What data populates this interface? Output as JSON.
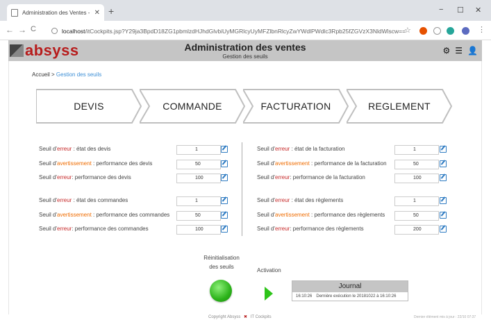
{
  "browser": {
    "tab_title": "Administration des Ventes - gestic",
    "tab_close": "✕",
    "new_tab": "+",
    "url_host": "localhost",
    "url_path": "/itCockpits.jsp?Y29ja3BpdD18ZG1pbmlzdHJhdGlvbiUyMGRlcyUyMFZlbnRlcyZwYWdlPWdlc3Rpb25fZGVzX3NldWlscw==",
    "nav_back": "←",
    "nav_forward": "→",
    "nav_reload": "C",
    "star": "☆",
    "win_minimize": "−",
    "win_maximize": "☐",
    "win_close": "✕",
    "menu": "⋮"
  },
  "header": {
    "logo": "absyss",
    "title": "Administration des ventes",
    "subtitle": "Gestion des seuils",
    "icons": [
      "gear-icon",
      "list-icon",
      "user-icon"
    ]
  },
  "breadcrumb": {
    "home": "Accueil",
    "sep": " > ",
    "current": "Gestion des seuils"
  },
  "process_steps": [
    "DEVIS",
    "COMMANDE",
    "FACTURATION",
    "REGLEMENT"
  ],
  "thresholds": {
    "left": [
      {
        "pre": "Seuil d'",
        "kind": "erreur",
        "post": " : état des devis",
        "value": "1"
      },
      {
        "pre": "Seuil d'",
        "kind": "avertissement",
        "post": " : performance des devis",
        "value": "50"
      },
      {
        "pre": "Seuil d'",
        "kind": "erreur",
        "post": ": performance des devis",
        "value": "100"
      },
      {
        "pre": "Seuil d'",
        "kind": "erreur",
        "post": " : état des commandes",
        "value": "1"
      },
      {
        "pre": "Seuil d'",
        "kind": "avertissement",
        "post": " : performance des commandes",
        "value": "50"
      },
      {
        "pre": "Seuil d'",
        "kind": "erreur",
        "post": ": performance des commandes",
        "value": "100"
      }
    ],
    "right": [
      {
        "pre": "Seuil d'",
        "kind": "erreur",
        "post": " : état de la facturation",
        "value": "1"
      },
      {
        "pre": "Seuil d'",
        "kind": "avertissement",
        "post": " : performance de la facturation",
        "value": "50"
      },
      {
        "pre": "Seuil d'",
        "kind": "erreur",
        "post": ": performance de la facturation",
        "value": "100"
      },
      {
        "pre": "Seuil d'",
        "kind": "erreur",
        "post": " : état des règlements",
        "value": "1"
      },
      {
        "pre": "Seuil d'",
        "kind": "avertissement",
        "post": " : performance des règlements",
        "value": "50"
      },
      {
        "pre": "Seuil d'",
        "kind": "erreur",
        "post": ": performance des règlements",
        "value": "200"
      }
    ]
  },
  "reinit": {
    "line1": "Réinitialisation",
    "line2": "des seuils"
  },
  "activation_label": "Activation",
  "journal": {
    "title": "Journal",
    "time": "16:10:26",
    "message": "Dernière exécution le 20181022 à 16:10:26"
  },
  "footer": {
    "copyright": "Copyright Absyss",
    "product": "IT Cockpits",
    "right": "Dernier élément mis à jour : 22/10 07:37"
  },
  "colors": {
    "error": "#c62828",
    "warning": "#ef6c00",
    "link": "#3d8fd6",
    "header_bg": "#c5c5c5",
    "status_ok": "#2cb31a"
  }
}
